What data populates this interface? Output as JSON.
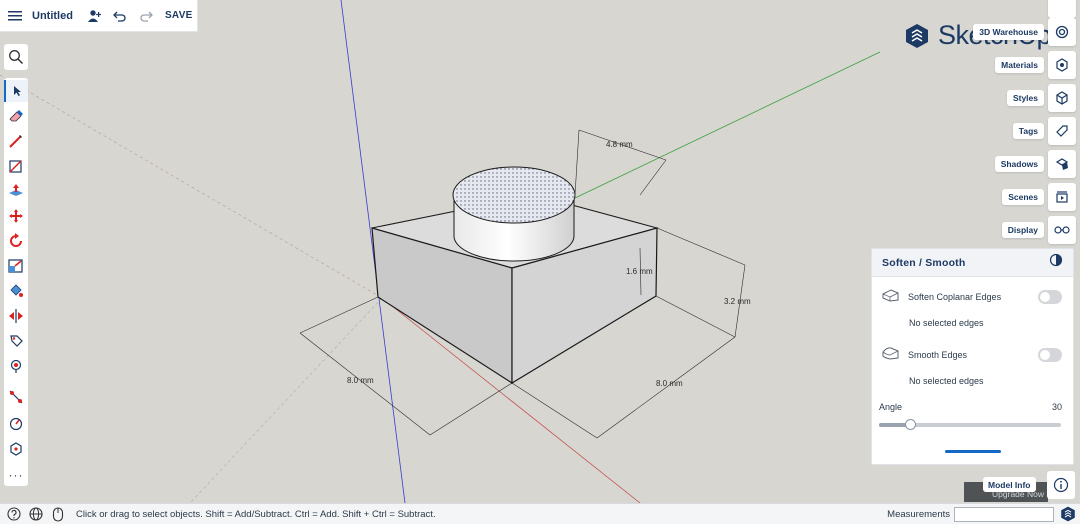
{
  "topbar": {
    "menu_icon": "hamburger-icon",
    "title": "Untitled",
    "user_icon": "add-user-icon",
    "undo_icon": "undo-icon",
    "redo_icon": "redo-icon",
    "save_label": "SAVE"
  },
  "left_toolbar": {
    "search_icon": "search-icon",
    "tools": [
      {
        "icon": "select-arrow-icon",
        "active": true
      },
      {
        "icon": "eraser-icon"
      },
      {
        "icon": "pencil-line-icon"
      },
      {
        "icon": "rectangle-icon"
      },
      {
        "icon": "push-pull-icon"
      },
      {
        "icon": "move-icon"
      },
      {
        "icon": "rotate-icon"
      },
      {
        "icon": "scale-icon"
      },
      {
        "icon": "paint-bucket-icon"
      },
      {
        "icon": "flip-icon"
      },
      {
        "icon": "tag-tool-icon"
      },
      {
        "icon": "position-camera-icon"
      },
      {
        "icon": "tape-measure-icon"
      },
      {
        "icon": "compass-icon"
      },
      {
        "icon": "orbit-icon"
      }
    ],
    "more_label": "···"
  },
  "logo": {
    "text": "SketchUp"
  },
  "right_panel": {
    "items": [
      {
        "label": "3D Warehouse",
        "icon": "warehouse-icon"
      },
      {
        "label": "Materials",
        "icon": "materials-icon"
      },
      {
        "label": "Styles",
        "icon": "styles-icon"
      },
      {
        "label": "Tags",
        "icon": "tags-icon"
      },
      {
        "label": "Shadows",
        "icon": "shadows-icon"
      },
      {
        "label": "Scenes",
        "icon": "scenes-icon"
      },
      {
        "label": "Display",
        "icon": "glasses-icon"
      }
    ]
  },
  "soften_panel": {
    "title": "Soften / Smooth",
    "soften_coplanar_label": "Soften Coplanar Edges",
    "soften_coplanar_note": "No selected edges",
    "smooth_edges_label": "Smooth Edges",
    "smooth_edges_note": "No selected edges",
    "angle_label": "Angle",
    "angle_value": "30",
    "angle_slider_fraction": 0.17
  },
  "bottom_right": {
    "upgrade_label": "Upgrade Now",
    "model_info_label": "Model Info"
  },
  "model": {
    "dimensions": {
      "cylinder_diameter": "4.8 mm",
      "cylinder_height": "1.6 mm",
      "box_height": "3.2 mm",
      "box_width": "8.0 mm",
      "box_depth": "8.0 mm"
    }
  },
  "statusbar": {
    "message": "Click or drag to select objects. Shift = Add/Subtract. Ctrl = Add. Shift + Ctrl = Subtract.",
    "measurements_label": "Measurements",
    "measurements_value": ""
  }
}
